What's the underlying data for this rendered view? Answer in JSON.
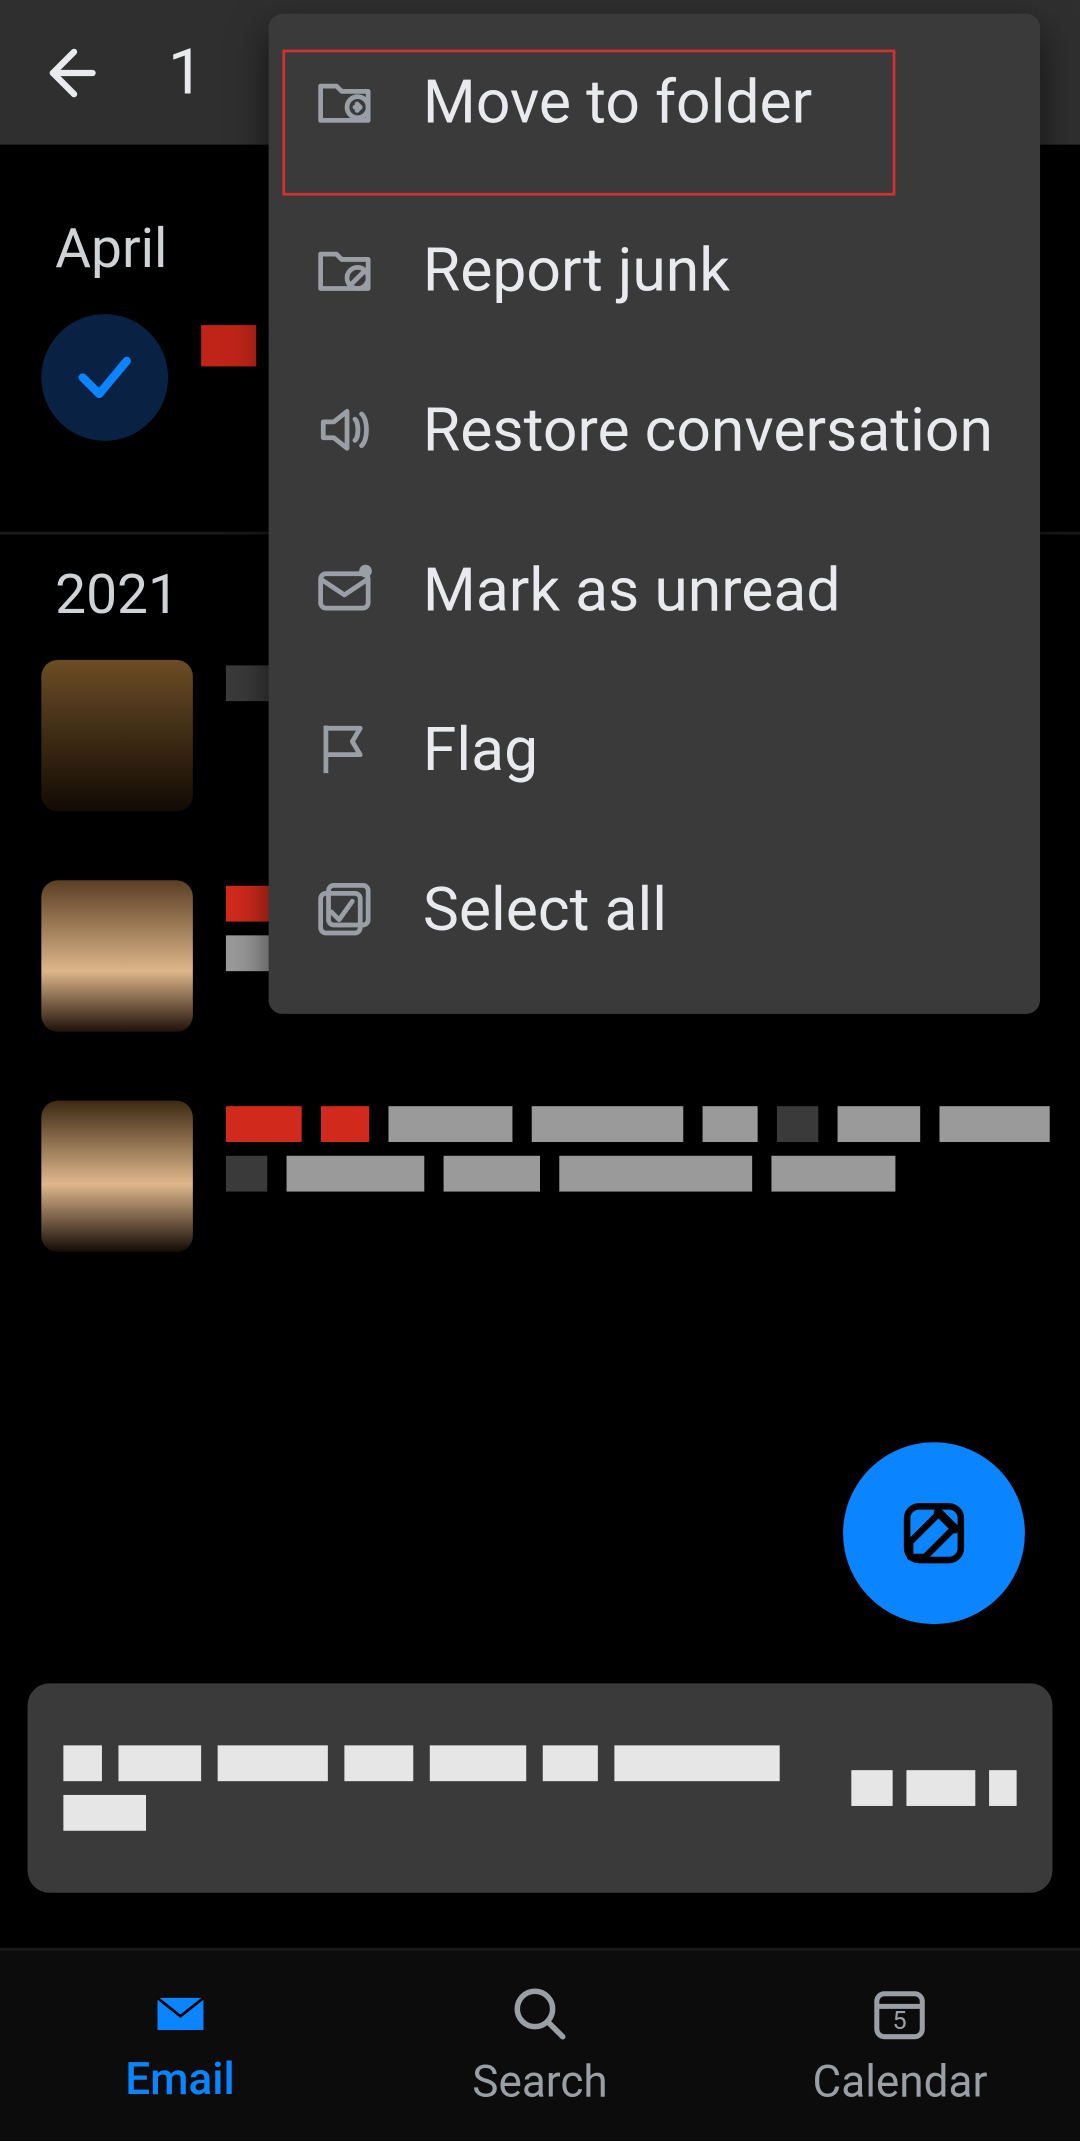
{
  "appbar": {
    "selected_count": "1"
  },
  "menu": {
    "items": [
      {
        "label": "Move to folder"
      },
      {
        "label": "Report junk"
      },
      {
        "label": "Restore conversation"
      },
      {
        "label": "Mark as unread"
      },
      {
        "label": "Flag"
      },
      {
        "label": "Select all"
      }
    ]
  },
  "sections": {
    "month": "April",
    "year": "2021"
  },
  "tabs": {
    "email": "Email",
    "search": "Search",
    "calendar": "Calendar",
    "calendar_badge": "5"
  },
  "colors": {
    "accent": "#0b84ff",
    "menu_bg": "#3a3a3a",
    "highlight": "#d03232"
  }
}
